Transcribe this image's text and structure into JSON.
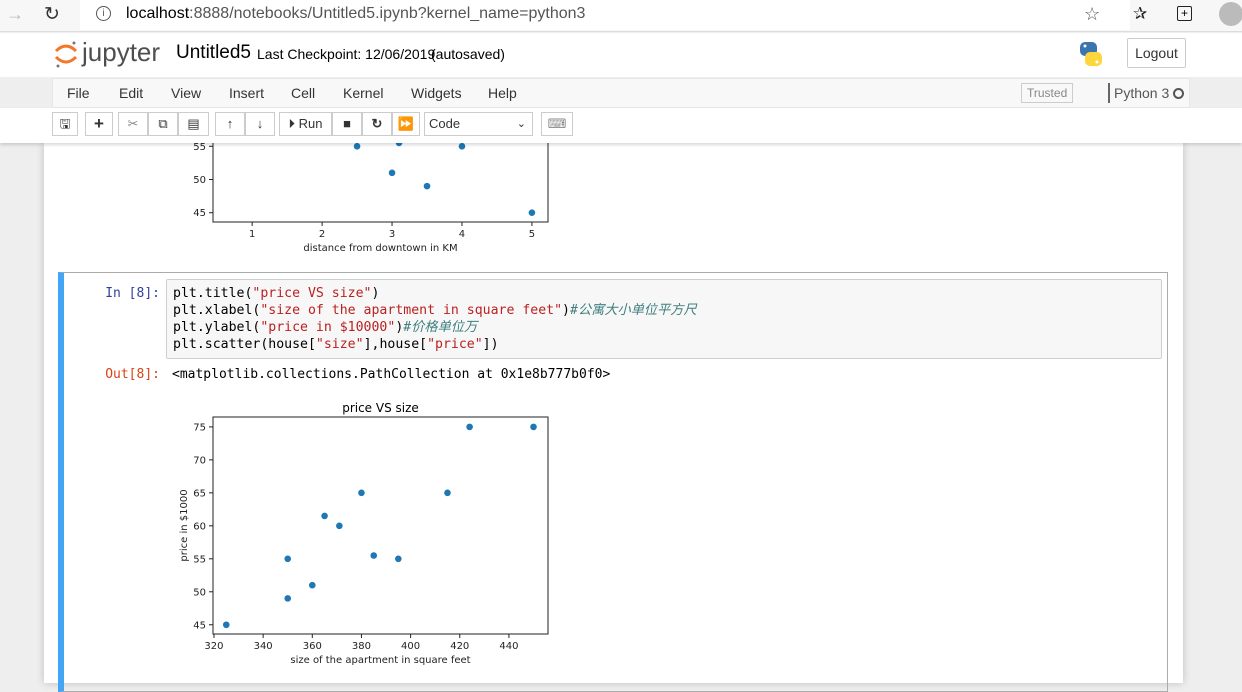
{
  "browser": {
    "url_host": "localhost",
    "url_rest": ":8888/notebooks/Untitled5.ipynb?kernel_name=python3"
  },
  "header": {
    "logo_text": "jupyter",
    "notebook_name": "Untitled5",
    "checkpoint": "Last Checkpoint: 12/06/2019",
    "autosave": "(autosaved)",
    "logout": "Logout"
  },
  "menu": {
    "items": [
      "File",
      "Edit",
      "View",
      "Insert",
      "Cell",
      "Kernel",
      "Widgets",
      "Help"
    ],
    "trusted": "Trusted",
    "kernel": "Python 3"
  },
  "toolbar": {
    "run": "Run",
    "cell_type": "Code"
  },
  "cell": {
    "in_prompt": "In [8]:",
    "out_prompt": "Out[8]:",
    "output_text": "<matplotlib.collections.PathCollection at 0x1e8b777b0f0>",
    "code": [
      [
        {
          "t": "plt.title(",
          "k": ""
        },
        {
          "t": "\"price VS size\"",
          "k": "s"
        },
        {
          "t": ")",
          "k": ""
        }
      ],
      [
        {
          "t": "plt.xlabel(",
          "k": ""
        },
        {
          "t": "\"size of the apartment in square feet\"",
          "k": "s"
        },
        {
          "t": ")",
          "k": ""
        },
        {
          "t": "#公寓大小单位平方尺",
          "k": "c"
        }
      ],
      [
        {
          "t": "plt.ylabel(",
          "k": ""
        },
        {
          "t": "\"price in $10000\"",
          "k": "s"
        },
        {
          "t": ")",
          "k": ""
        },
        {
          "t": "#价格单位万",
          "k": "c"
        }
      ],
      [
        {
          "t": "plt.scatter(house[",
          "k": ""
        },
        {
          "t": "\"size\"",
          "k": "s"
        },
        {
          "t": "],house[",
          "k": ""
        },
        {
          "t": "\"price\"",
          "k": "s"
        },
        {
          "t": "])",
          "k": ""
        }
      ]
    ]
  },
  "chart_data": [
    {
      "type": "scatter",
      "title": "",
      "xlabel": "distance from downtown in KM",
      "ylabel": "",
      "xlim": [
        0.44,
        5.23
      ],
      "ylim": [
        43.6,
        57
      ],
      "xticks": [
        1,
        2,
        3,
        4,
        5
      ],
      "yticks": [
        45,
        50,
        55
      ],
      "color": "#1f77b4",
      "points": [
        [
          2.5,
          55
        ],
        [
          3.1,
          55.5
        ],
        [
          3,
          51
        ],
        [
          3.5,
          49
        ],
        [
          4,
          55
        ],
        [
          5,
          45
        ]
      ]
    },
    {
      "type": "scatter",
      "title": "price VS size",
      "xlabel": "size of the apartment in square feet",
      "ylabel": "price in $1000",
      "xlim": [
        319.6,
        455.9
      ],
      "ylim": [
        43.6,
        76.5
      ],
      "xticks": [
        320,
        340,
        360,
        380,
        400,
        420,
        440
      ],
      "yticks": [
        45,
        50,
        55,
        60,
        65,
        70,
        75
      ],
      "color": "#1f77b4",
      "points": [
        [
          325,
          45
        ],
        [
          350,
          55
        ],
        [
          350,
          49
        ],
        [
          360,
          51
        ],
        [
          365,
          61.5
        ],
        [
          371,
          60
        ],
        [
          380,
          65
        ],
        [
          385,
          55.5
        ],
        [
          395,
          55
        ],
        [
          415,
          65
        ],
        [
          424,
          75
        ],
        [
          450,
          75
        ]
      ]
    }
  ]
}
